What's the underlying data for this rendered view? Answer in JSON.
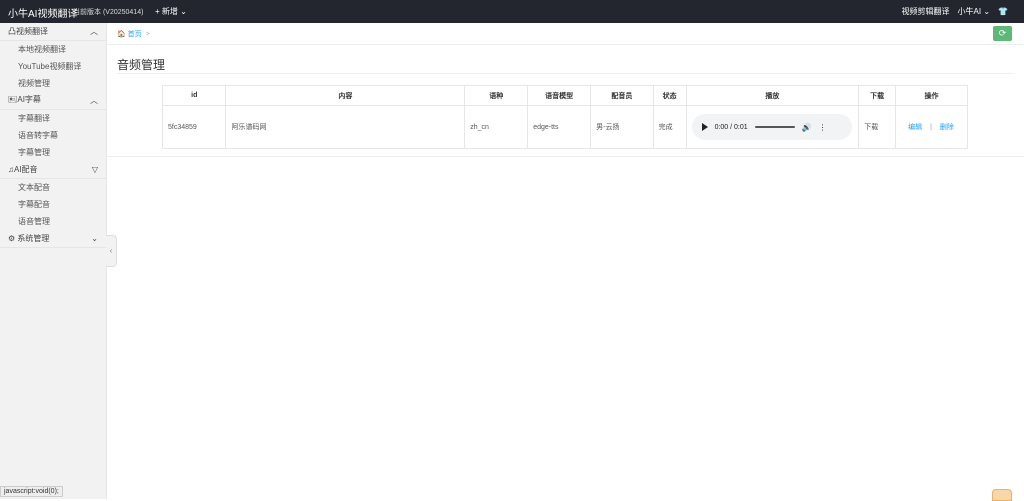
{
  "header": {
    "brand": "小牛AI视频翻译",
    "version": "当前版本 (V20250414)",
    "new_label": "+ 新增 ⌄",
    "right_link": "视频剪辑翻译",
    "user": "小牛AI ⌄",
    "shirt_icon": "👕"
  },
  "sidebar": {
    "groups": [
      {
        "label": "凸视频翻译",
        "arrow": "︿",
        "items": [
          "本地视频翻译",
          "YouTube视频翻译",
          "视频管理"
        ]
      },
      {
        "label": "🖭AI字幕",
        "arrow": "︿",
        "items": [
          "字幕翻译",
          "语音转字幕",
          "字幕管理"
        ]
      },
      {
        "label": "♫AI配音",
        "arrow": "▽",
        "items": [
          "文本配音",
          "字幕配音",
          "语音管理"
        ]
      },
      {
        "label": "⚙ 系统管理",
        "arrow": "⌄",
        "items": []
      }
    ],
    "toggle": "‹"
  },
  "breadcrumb": {
    "home": "🏠 首页",
    "sep": ">"
  },
  "page_title": "音频管理",
  "table": {
    "headers": [
      "id",
      "内容",
      "语种",
      "语音模型",
      "配音员",
      "状态",
      "播放",
      "下载",
      "操作"
    ],
    "row": {
      "id": "5fc34859",
      "content": "阿乐谱码网",
      "lang": "zh_cn",
      "model": "edge-tts",
      "voice": "男-云扬",
      "status": "完成",
      "audio_time": "0:00 / 0:01",
      "download": "下载",
      "edit": "编辑",
      "divider": "|",
      "delete": "删除"
    }
  },
  "statusbar": "javascript:void(0);",
  "refresh_icon": "⟳"
}
